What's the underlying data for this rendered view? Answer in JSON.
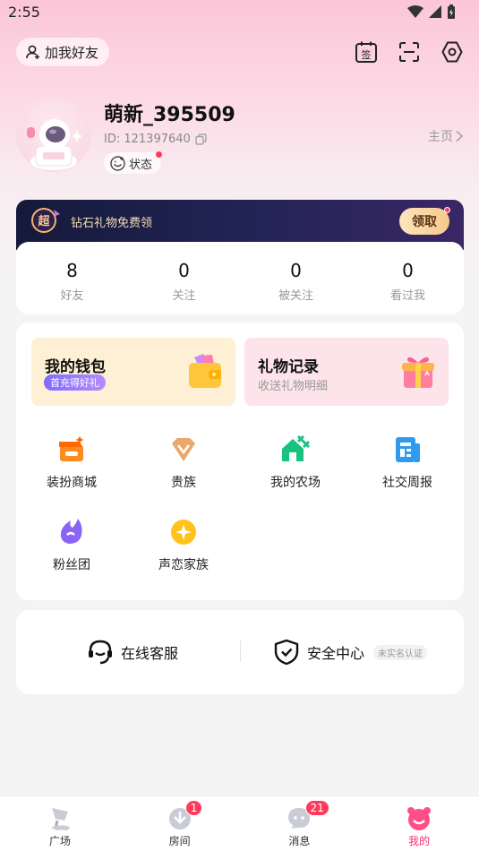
{
  "status_bar": {
    "time": "2:55"
  },
  "header": {
    "add_friend_label": "加我好友",
    "icons": [
      "sign-in-icon",
      "scan-icon",
      "settings-icon"
    ],
    "checkin_glyph": "签"
  },
  "profile": {
    "nickname": "萌新_395509",
    "id_text": "ID: 121397640",
    "status_label": "状态",
    "homepage_label": "主页"
  },
  "promo": {
    "badge_text": "超",
    "text": "钻石礼物免费领",
    "button_label": "领取"
  },
  "stats": [
    {
      "value": "8",
      "label": "好友"
    },
    {
      "value": "0",
      "label": "关注"
    },
    {
      "value": "0",
      "label": "被关注"
    },
    {
      "value": "0",
      "label": "看过我"
    }
  ],
  "wallet": {
    "title": "我的钱包",
    "tag": "首充得好礼"
  },
  "gift_records": {
    "title": "礼物记录",
    "subtitle": "收送礼物明细"
  },
  "features": [
    {
      "label": "装扮商城",
      "icon": "shop-icon"
    },
    {
      "label": "贵族",
      "icon": "diamond-icon"
    },
    {
      "label": "我的农场",
      "icon": "farm-icon"
    },
    {
      "label": "社交周报",
      "icon": "report-icon"
    },
    {
      "label": "粉丝团",
      "icon": "fan-club-icon"
    },
    {
      "label": "声恋家族",
      "icon": "family-icon"
    }
  ],
  "services": {
    "online_support": "在线客服",
    "security_center": "安全中心",
    "verify_status": "未实名认证"
  },
  "bottom_nav": [
    {
      "label": "广场",
      "badge": ""
    },
    {
      "label": "房间",
      "badge": "1"
    },
    {
      "label": "消息",
      "badge": "21"
    },
    {
      "label": "我的",
      "badge": ""
    }
  ],
  "colors": {
    "accent": "#ff2d6f",
    "badge": "#ff3b5c",
    "wallet_bg": "#fdf0d4",
    "gifts_bg": "#fde3ea"
  }
}
